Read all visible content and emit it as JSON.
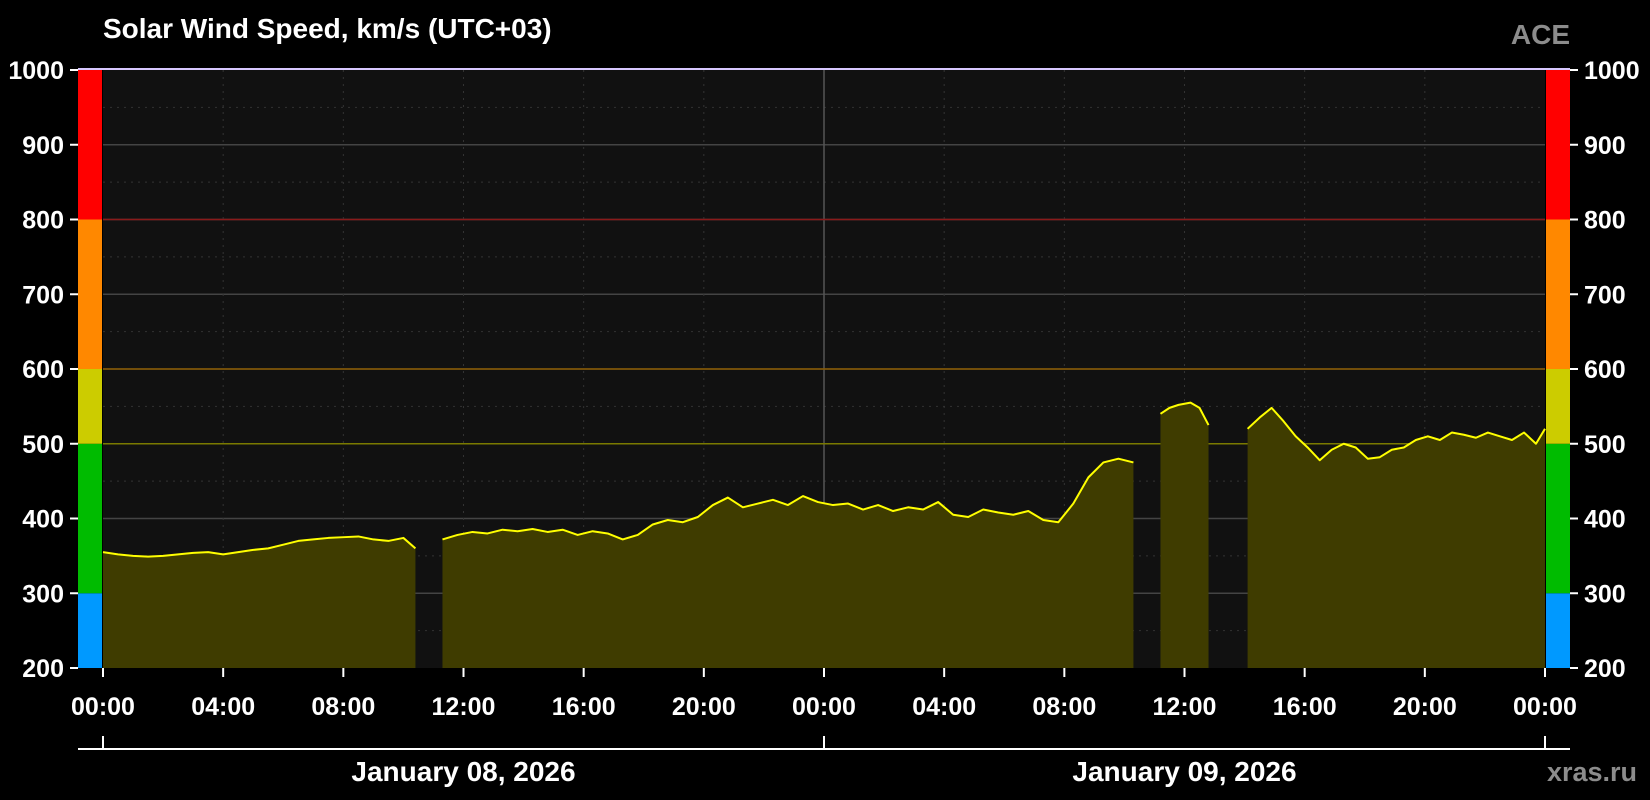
{
  "header": {
    "title": "Solar Wind Speed, km/s (UTC+03)",
    "source": "ACE"
  },
  "footer": {
    "credit": "xras.ru"
  },
  "colors": {
    "background": "#000000",
    "plot_background": "#111111",
    "line": "#ffff00",
    "fill": "#3f3c00",
    "scale_bands": [
      {
        "from": 200,
        "to": 300,
        "color": "#0099ff"
      },
      {
        "from": 300,
        "to": 500,
        "color": "#00bb00"
      },
      {
        "from": 500,
        "to": 600,
        "color": "#cccc00"
      },
      {
        "from": 600,
        "to": 800,
        "color": "#ff8800"
      },
      {
        "from": 800,
        "to": 1000,
        "color": "#ff0000"
      }
    ],
    "threshold_lines": [
      {
        "value": 500,
        "color": "#7a7a00"
      },
      {
        "value": 600,
        "color": "#8a5a00"
      },
      {
        "value": 800,
        "color": "#8a1a1a"
      }
    ]
  },
  "chart_data": {
    "type": "area",
    "title": "Solar Wind Speed, km/s (UTC+03)",
    "ylim": [
      200,
      1000
    ],
    "yticks": [
      200,
      300,
      400,
      500,
      600,
      700,
      800,
      900,
      1000
    ],
    "xlim_hours": [
      0,
      48
    ],
    "xticks": [
      {
        "hour": 0,
        "label": "00:00"
      },
      {
        "hour": 4,
        "label": "04:00"
      },
      {
        "hour": 8,
        "label": "08:00"
      },
      {
        "hour": 12,
        "label": "12:00"
      },
      {
        "hour": 16,
        "label": "16:00"
      },
      {
        "hour": 20,
        "label": "20:00"
      },
      {
        "hour": 24,
        "label": "00:00"
      },
      {
        "hour": 28,
        "label": "04:00"
      },
      {
        "hour": 32,
        "label": "08:00"
      },
      {
        "hour": 36,
        "label": "12:00"
      },
      {
        "hour": 40,
        "label": "16:00"
      },
      {
        "hour": 44,
        "label": "20:00"
      },
      {
        "hour": 48,
        "label": "00:00"
      }
    ],
    "dates": [
      {
        "label": "January 08, 2026",
        "center_hour": 12
      },
      {
        "label": "January 09, 2026",
        "center_hour": 36
      }
    ],
    "grid": true,
    "series": [
      {
        "x_hours": [
          0,
          0.5,
          1,
          1.5,
          2,
          2.5,
          3,
          3.5,
          4,
          4.5,
          5,
          5.5,
          6,
          6.5,
          7,
          7.5,
          8,
          8.5,
          9,
          9.5,
          10,
          10.4,
          11.3,
          11.8,
          12.3,
          12.8,
          13.3,
          13.8,
          14.3,
          14.8,
          15.3,
          15.8,
          16.3,
          16.8,
          17.3,
          17.8,
          18.3,
          18.8,
          19.3,
          19.8,
          20.3,
          20.8,
          21.3,
          21.8,
          22.3,
          22.8,
          23.3,
          23.8,
          24.3,
          24.8,
          25.3,
          25.8,
          26.3,
          26.8,
          27.3,
          27.8,
          28.3,
          28.8,
          29.3,
          29.8,
          30.3,
          30.8,
          31.3,
          31.8,
          32.3,
          32.8,
          33.3,
          33.8,
          34.3,
          35.2,
          35.5,
          35.8,
          36.2,
          36.5,
          36.8,
          38.1,
          38.5,
          38.9,
          39.3,
          39.7,
          40.1,
          40.5,
          40.9,
          41.3,
          41.7,
          42.1,
          42.5,
          42.9,
          43.3,
          43.7,
          44.1,
          44.5,
          44.9,
          45.3,
          45.7,
          46.1,
          46.5,
          46.9,
          47.3,
          47.7,
          48
        ],
        "values": [
          355,
          352,
          350,
          349,
          350,
          352,
          354,
          355,
          352,
          355,
          358,
          360,
          365,
          370,
          372,
          374,
          375,
          376,
          372,
          370,
          374,
          360,
          372,
          378,
          382,
          380,
          385,
          383,
          386,
          382,
          385,
          378,
          383,
          380,
          372,
          378,
          392,
          398,
          395,
          402,
          418,
          428,
          415,
          420,
          425,
          418,
          430,
          422,
          418,
          420,
          412,
          418,
          410,
          415,
          412,
          422,
          405,
          402,
          412,
          408,
          405,
          410,
          398,
          395,
          420,
          455,
          475,
          480,
          475,
          540,
          548,
          552,
          555,
          548,
          525,
          520,
          535,
          548,
          530,
          510,
          495,
          478,
          492,
          500,
          495,
          480,
          482,
          492,
          495,
          505,
          510,
          505,
          515,
          512,
          508,
          515,
          510,
          505,
          515,
          500,
          520
        ]
      }
    ],
    "gaps_hours": [
      [
        10.4,
        11.3
      ],
      [
        34.3,
        35.2
      ],
      [
        36.8,
        38.1
      ]
    ]
  }
}
